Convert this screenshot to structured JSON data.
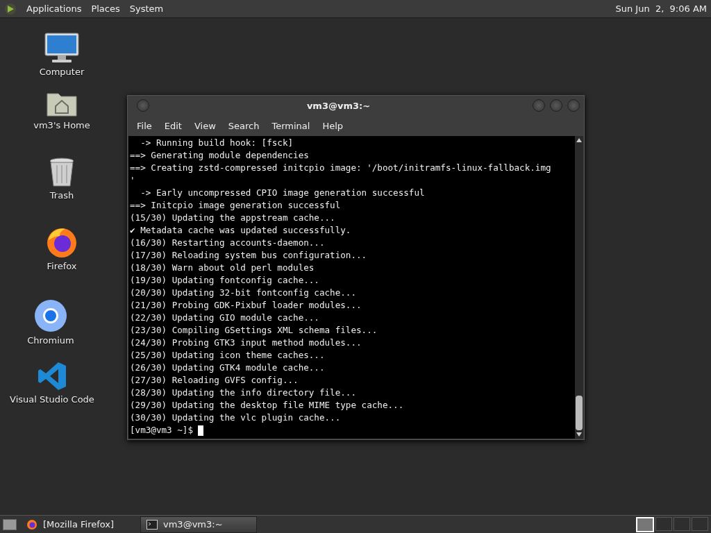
{
  "top_panel": {
    "menus": [
      "Applications",
      "Places",
      "System"
    ],
    "clock": "Sun Jun  2,  9:06 AM"
  },
  "desktop_icons": [
    {
      "kind": "computer",
      "label": "Computer"
    },
    {
      "kind": "home",
      "label": "vm3's Home"
    },
    {
      "kind": "trash",
      "label": "Trash"
    },
    {
      "kind": "firefox",
      "label": "Firefox"
    },
    {
      "kind": "chromium",
      "label": "Chromium"
    },
    {
      "kind": "vscode",
      "label": "Visual Studio Code"
    }
  ],
  "terminal": {
    "title": "vm3@vm3:~",
    "menus": [
      "File",
      "Edit",
      "View",
      "Search",
      "Terminal",
      "Help"
    ],
    "lines": [
      "  -> Running build hook: [fsck]",
      "==> Generating module dependencies",
      "==> Creating zstd-compressed initcpio image: '/boot/initramfs-linux-fallback.img",
      "'",
      "  -> Early uncompressed CPIO image generation successful",
      "==> Initcpio image generation successful",
      "(15/30) Updating the appstream cache...",
      "✔ Metadata cache was updated successfully.",
      "(16/30) Restarting accounts-daemon...",
      "(17/30) Reloading system bus configuration...",
      "(18/30) Warn about old perl modules",
      "(19/30) Updating fontconfig cache...",
      "(20/30) Updating 32-bit fontconfig cache...",
      "(21/30) Probing GDK-Pixbuf loader modules...",
      "(22/30) Updating GIO module cache...",
      "(23/30) Compiling GSettings XML schema files...",
      "(24/30) Probing GTK3 input method modules...",
      "(25/30) Updating icon theme caches...",
      "(26/30) Updating GTK4 module cache...",
      "(27/30) Reloading GVFS config...",
      "(28/30) Updating the info directory file...",
      "(29/30) Updating the desktop file MIME type cache...",
      "(30/30) Updating the vlc plugin cache..."
    ],
    "prompt": "[vm3@vm3 ~]$"
  },
  "taskbar": {
    "items": [
      {
        "kind": "firefox",
        "label": "[Mozilla Firefox]",
        "selected": false
      },
      {
        "kind": "terminal",
        "label": "vm3@vm3:~",
        "selected": true
      }
    ],
    "workspaces": [
      {
        "selected": true
      },
      {
        "selected": false
      },
      {
        "selected": false
      },
      {
        "selected": false
      }
    ]
  }
}
